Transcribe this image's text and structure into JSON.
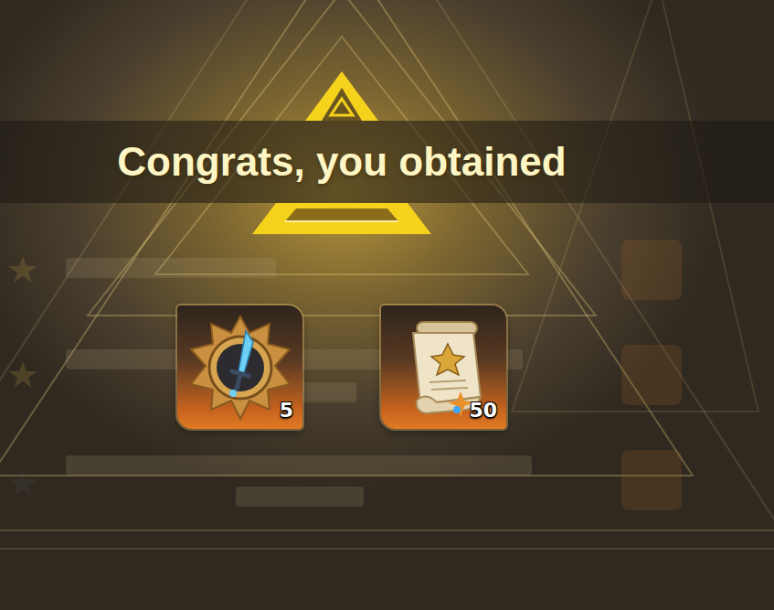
{
  "title": "Congrats, you obtained",
  "rewards": [
    {
      "kind": "emblem",
      "count": "5"
    },
    {
      "kind": "scroll",
      "count": "50"
    }
  ]
}
